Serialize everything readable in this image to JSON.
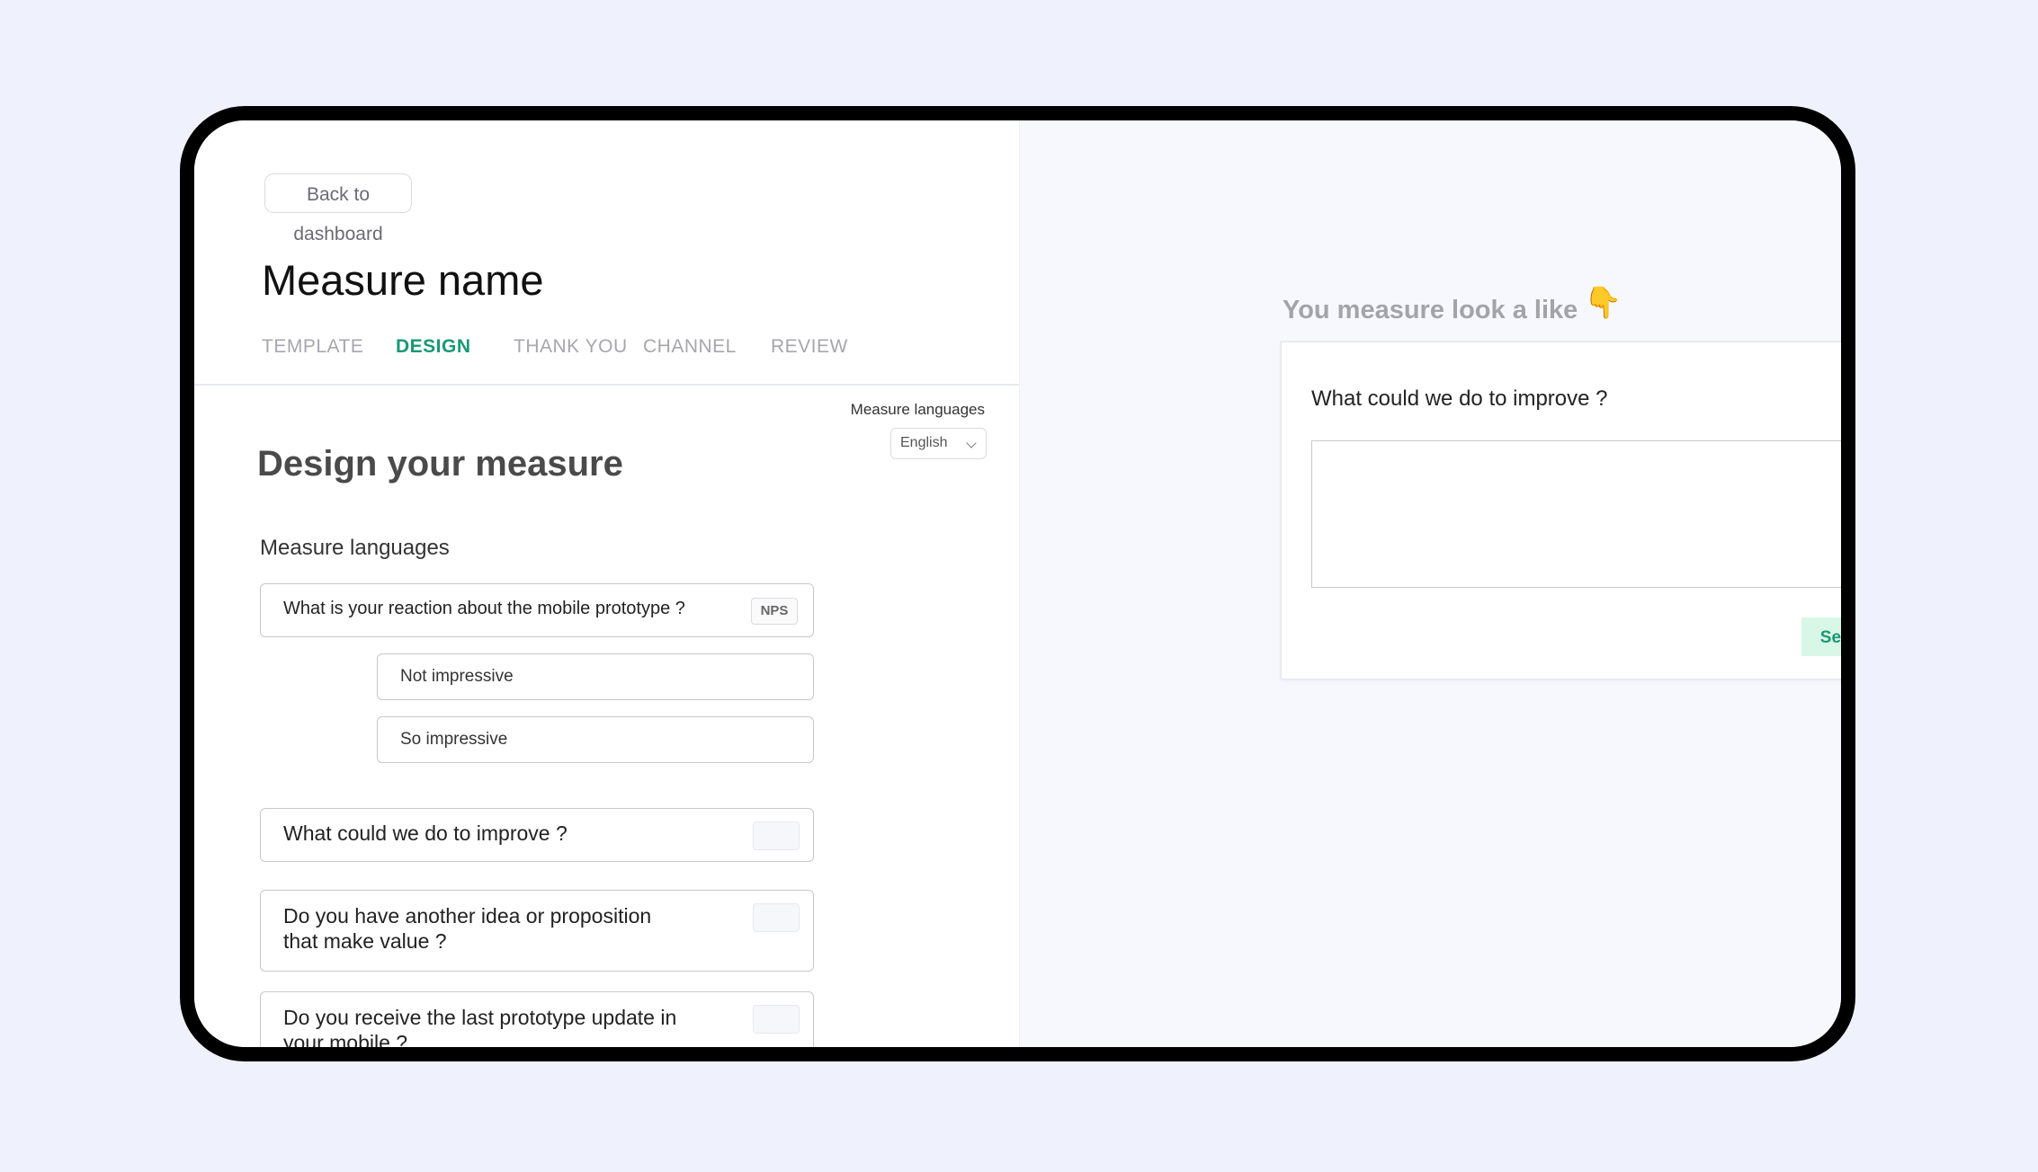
{
  "header": {
    "back_label": "Back to dashboard",
    "title": "Measure name"
  },
  "tabs": [
    {
      "label": "TEMPLATE",
      "active": false
    },
    {
      "label": "DESIGN",
      "active": true
    },
    {
      "label": "THANK YOU",
      "active": false
    },
    {
      "label": "CHANNEL",
      "active": false
    },
    {
      "label": "REVIEW",
      "active": false
    }
  ],
  "language": {
    "label": "Measure languages",
    "selected": "English"
  },
  "design": {
    "heading": "Design your measure",
    "section_label": "Measure languages",
    "questions": [
      {
        "text": "What is your reaction about the mobile prototype ?",
        "tag": "NPS",
        "answers": [
          "Not impressive",
          "So impressive"
        ]
      },
      {
        "text": "What could we do to improve ?",
        "tag": ""
      },
      {
        "text_line1": "Do you have another idea or proposition",
        "text_line2": "that make value ?",
        "tag": ""
      },
      {
        "text_line1": "Do you receive the last prototype update in",
        "text_line2": "your mobile ?",
        "tag": ""
      }
    ]
  },
  "preview": {
    "heading": "You measure look a like",
    "icon": "pointing-down-hand-icon",
    "question": "What could we do to improve ?",
    "send_label": "Send"
  },
  "colors": {
    "accent": "#1a9876",
    "send_bg": "#d8f7e6",
    "page_bg": "#eff2fd",
    "preview_bg": "#f7f8fd"
  }
}
